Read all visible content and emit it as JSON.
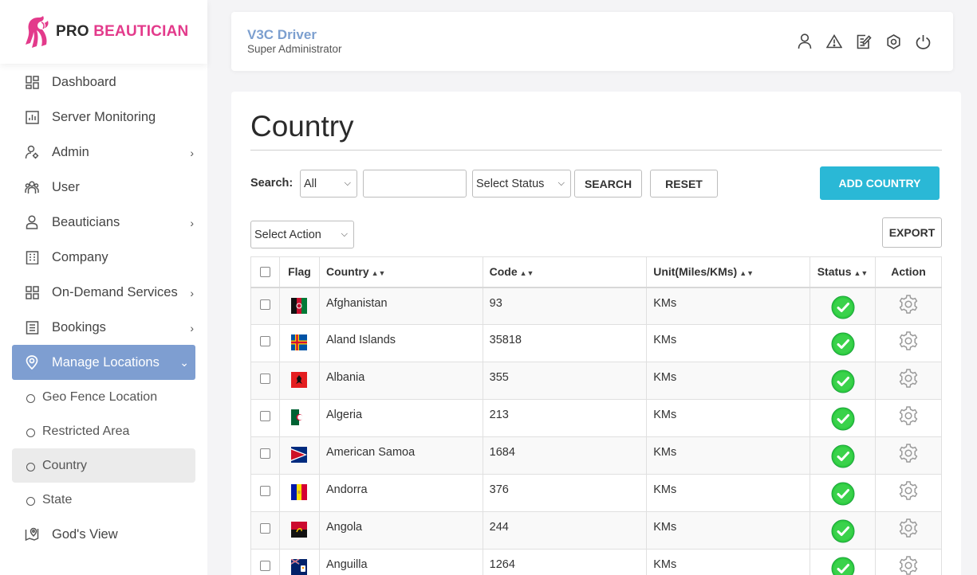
{
  "brand": {
    "pro": "PRO",
    "beautician": "BEAUTICIAN"
  },
  "sidebar": {
    "items": [
      {
        "label": "Dashboard",
        "icon": "dashboard-icon"
      },
      {
        "label": "Server Monitoring",
        "icon": "monitor-icon"
      },
      {
        "label": "Admin",
        "icon": "admin-icon",
        "has_children": true
      },
      {
        "label": "User",
        "icon": "users-icon"
      },
      {
        "label": "Beauticians",
        "icon": "person-icon",
        "has_children": true
      },
      {
        "label": "Company",
        "icon": "company-icon"
      },
      {
        "label": "On-Demand Services",
        "icon": "grid-icon",
        "has_children": true
      },
      {
        "label": "Bookings",
        "icon": "bookings-icon",
        "has_children": true
      },
      {
        "label": "Manage Locations",
        "icon": "location-icon",
        "has_children": true,
        "active": true
      }
    ],
    "sub_items": [
      {
        "label": "Geo Fence Location"
      },
      {
        "label": "Restricted Area"
      },
      {
        "label": "Country",
        "selected": true
      },
      {
        "label": "State"
      }
    ],
    "after": {
      "label": "God's View",
      "icon": "gods-view-icon"
    }
  },
  "header": {
    "name": "V3C Driver",
    "role": "Super Administrator"
  },
  "page": {
    "title": "Country",
    "search_label": "Search:",
    "search_field_select": "All",
    "search_placeholder": "",
    "status_select": "Select Status",
    "search_button": "SEARCH",
    "reset_button": "RESET",
    "add_button": "ADD COUNTRY",
    "action_select": "Select Action",
    "export_button": "EXPORT"
  },
  "table": {
    "columns": [
      "Flag",
      "Country",
      "Code",
      "Unit(Miles/KMs)",
      "Status",
      "Action"
    ],
    "rows": [
      {
        "country": "Afghanistan",
        "code": "93",
        "unit": "KMs"
      },
      {
        "country": "Aland Islands",
        "code": "35818",
        "unit": "KMs"
      },
      {
        "country": "Albania",
        "code": "355",
        "unit": "KMs"
      },
      {
        "country": "Algeria",
        "code": "213",
        "unit": "KMs"
      },
      {
        "country": "American Samoa",
        "code": "1684",
        "unit": "KMs"
      },
      {
        "country": "Andorra",
        "code": "376",
        "unit": "KMs"
      },
      {
        "country": "Angola",
        "code": "244",
        "unit": "KMs"
      },
      {
        "country": "Anguilla",
        "code": "1264",
        "unit": "KMs"
      }
    ]
  },
  "colors": {
    "accent": "#2ab8d6",
    "active_nav": "#7e9ed1",
    "brand_pink": "#e33a8b",
    "status_green": "#2ecc40"
  }
}
